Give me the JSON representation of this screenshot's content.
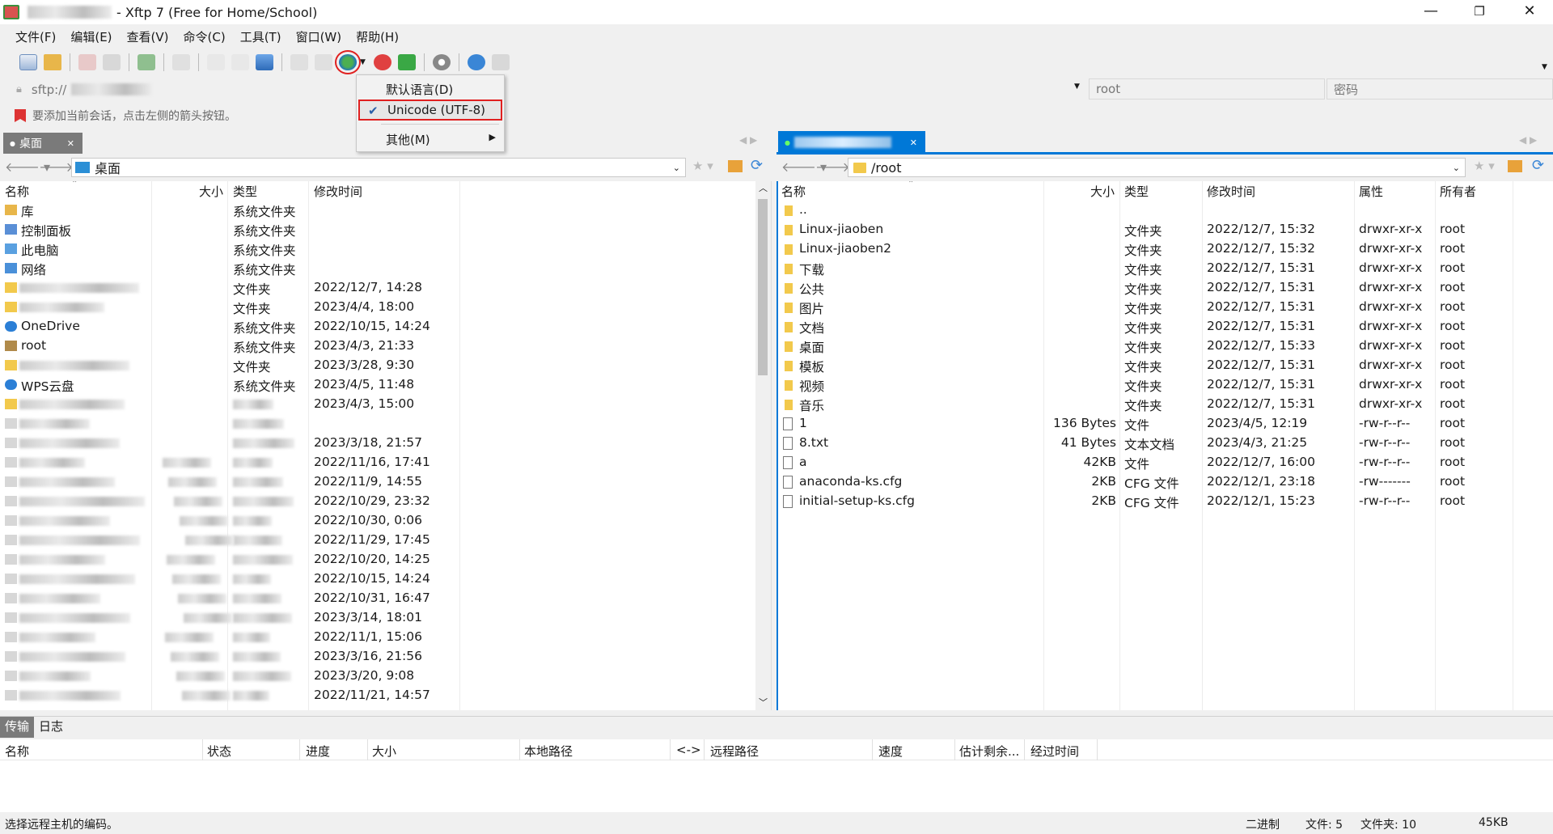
{
  "window": {
    "title": "- Xftp 7 (Free for Home/School)",
    "minimize": "—",
    "restore": "❐",
    "close": "✕"
  },
  "menu": [
    "文件(F)",
    "编辑(E)",
    "查看(V)",
    "命令(C)",
    "工具(T)",
    "窗口(W)",
    "帮助(H)"
  ],
  "address": {
    "host_prefix": "sftp://",
    "user": "root",
    "password_placeholder": "密码"
  },
  "hint": "要添加当前会话，点击左侧的箭头按钮。",
  "encoding_menu": {
    "items": [
      "默认语言(D)",
      "Unicode (UTF-8)",
      "其他(M)"
    ],
    "checked": "Unicode (UTF-8)"
  },
  "local": {
    "tab": "桌面",
    "path": "桌面",
    "columns": [
      "名称",
      "大小",
      "类型",
      "修改时间"
    ],
    "rows": [
      {
        "name": "库",
        "size": "",
        "type": "系统文件夹",
        "date": "",
        "icon": "library-icon",
        "blur": false
      },
      {
        "name": "控制面板",
        "size": "",
        "type": "系统文件夹",
        "date": "",
        "icon": "control-panel-icon",
        "blur": false
      },
      {
        "name": "此电脑",
        "size": "",
        "type": "系统文件夹",
        "date": "",
        "icon": "computer-icon",
        "blur": false
      },
      {
        "name": "网络",
        "size": "",
        "type": "系统文件夹",
        "date": "",
        "icon": "network-icon",
        "blur": false
      },
      {
        "name": "",
        "size": "",
        "type": "文件夹",
        "date": "2022/12/7, 14:28",
        "icon": "folder-icon",
        "blur": true
      },
      {
        "name": "",
        "size": "",
        "type": "文件夹",
        "date": "2023/4/4, 18:00",
        "icon": "folder-icon",
        "blur": true
      },
      {
        "name": "OneDrive",
        "size": "",
        "type": "系统文件夹",
        "date": "2022/10/15, 14:24",
        "icon": "cloud-icon",
        "blur": false
      },
      {
        "name": "root",
        "size": "",
        "type": "系统文件夹",
        "date": "2023/4/3, 21:33",
        "icon": "user-icon",
        "blur": false
      },
      {
        "name": "",
        "size": "",
        "type": "文件夹",
        "date": "2023/3/28, 9:30",
        "icon": "folder-icon",
        "blur": true
      },
      {
        "name": "WPS云盘",
        "size": "",
        "type": "系统文件夹",
        "date": "2023/4/5, 11:48",
        "icon": "cloud-icon",
        "blur": false
      },
      {
        "name": "",
        "size": "",
        "type": "",
        "date": "2023/4/3, 15:00",
        "icon": "folder-icon",
        "blur": true
      },
      {
        "name": "",
        "size": "",
        "type": "",
        "date": "",
        "icon": "file-icon",
        "blur": true
      },
      {
        "name": "",
        "size": "",
        "type": "",
        "date": "2023/3/18, 21:57",
        "icon": "file-icon",
        "blur": true
      },
      {
        "name": "",
        "size": "",
        "type": "",
        "date": "2022/11/16, 17:41",
        "icon": "file-icon",
        "blur": true
      },
      {
        "name": "",
        "size": "",
        "type": "",
        "date": "2022/11/9, 14:55",
        "icon": "file-icon",
        "blur": true
      },
      {
        "name": "",
        "size": "",
        "type": "",
        "date": "2022/10/29, 23:32",
        "icon": "file-icon",
        "blur": true
      },
      {
        "name": "",
        "size": "",
        "type": "",
        "date": "2022/10/30, 0:06",
        "icon": "file-icon",
        "blur": true
      },
      {
        "name": "",
        "size": "",
        "type": "",
        "date": "2022/11/29, 17:45",
        "icon": "file-icon",
        "blur": true
      },
      {
        "name": "",
        "size": "",
        "type": "",
        "date": "2022/10/20, 14:25",
        "icon": "file-icon",
        "blur": true
      },
      {
        "name": "",
        "size": "",
        "type": "",
        "date": "2022/10/15, 14:24",
        "icon": "file-icon",
        "blur": true
      },
      {
        "name": "",
        "size": "",
        "type": "",
        "date": "2022/10/31, 16:47",
        "icon": "file-icon",
        "blur": true
      },
      {
        "name": "",
        "size": "",
        "type": "",
        "date": "2023/3/14, 18:01",
        "icon": "file-icon",
        "blur": true
      },
      {
        "name": "",
        "size": "",
        "type": "",
        "date": "2022/11/1, 15:06",
        "icon": "file-icon",
        "blur": true
      },
      {
        "name": "",
        "size": "",
        "type": "",
        "date": "2023/3/16, 21:56",
        "icon": "file-icon",
        "blur": true
      },
      {
        "name": "",
        "size": "",
        "type": "",
        "date": "2023/3/20, 9:08",
        "icon": "file-icon",
        "blur": true
      },
      {
        "name": "",
        "size": "",
        "type": "",
        "date": "2022/11/21, 14:57",
        "icon": "file-icon",
        "blur": true
      }
    ]
  },
  "remote": {
    "path": "/root",
    "columns": [
      "名称",
      "大小",
      "类型",
      "修改时间",
      "属性",
      "所有者"
    ],
    "rows": [
      {
        "name": "..",
        "size": "",
        "type": "",
        "date": "",
        "attr": "",
        "owner": "",
        "icon": "folder-icon"
      },
      {
        "name": "Linux-jiaoben",
        "size": "",
        "type": "文件夹",
        "date": "2022/12/7, 15:32",
        "attr": "drwxr-xr-x",
        "owner": "root",
        "icon": "folder-icon"
      },
      {
        "name": "Linux-jiaoben2",
        "size": "",
        "type": "文件夹",
        "date": "2022/12/7, 15:32",
        "attr": "drwxr-xr-x",
        "owner": "root",
        "icon": "folder-icon"
      },
      {
        "name": "下载",
        "size": "",
        "type": "文件夹",
        "date": "2022/12/7, 15:31",
        "attr": "drwxr-xr-x",
        "owner": "root",
        "icon": "folder-icon"
      },
      {
        "name": "公共",
        "size": "",
        "type": "文件夹",
        "date": "2022/12/7, 15:31",
        "attr": "drwxr-xr-x",
        "owner": "root",
        "icon": "folder-icon"
      },
      {
        "name": "图片",
        "size": "",
        "type": "文件夹",
        "date": "2022/12/7, 15:31",
        "attr": "drwxr-xr-x",
        "owner": "root",
        "icon": "folder-icon"
      },
      {
        "name": "文档",
        "size": "",
        "type": "文件夹",
        "date": "2022/12/7, 15:31",
        "attr": "drwxr-xr-x",
        "owner": "root",
        "icon": "folder-icon"
      },
      {
        "name": "桌面",
        "size": "",
        "type": "文件夹",
        "date": "2022/12/7, 15:33",
        "attr": "drwxr-xr-x",
        "owner": "root",
        "icon": "folder-icon"
      },
      {
        "name": "模板",
        "size": "",
        "type": "文件夹",
        "date": "2022/12/7, 15:31",
        "attr": "drwxr-xr-x",
        "owner": "root",
        "icon": "folder-icon"
      },
      {
        "name": "视频",
        "size": "",
        "type": "文件夹",
        "date": "2022/12/7, 15:31",
        "attr": "drwxr-xr-x",
        "owner": "root",
        "icon": "folder-icon"
      },
      {
        "name": "音乐",
        "size": "",
        "type": "文件夹",
        "date": "2022/12/7, 15:31",
        "attr": "drwxr-xr-x",
        "owner": "root",
        "icon": "folder-icon"
      },
      {
        "name": "1",
        "size": "136 Bytes",
        "type": "文件",
        "date": "2023/4/5, 12:19",
        "attr": "-rw-r--r--",
        "owner": "root",
        "icon": "file-icon"
      },
      {
        "name": "8.txt",
        "size": "41 Bytes",
        "type": "文本文档",
        "date": "2023/4/3, 21:25",
        "attr": "-rw-r--r--",
        "owner": "root",
        "icon": "file-icon"
      },
      {
        "name": "a",
        "size": "42KB",
        "type": "文件",
        "date": "2022/12/7, 16:00",
        "attr": "-rw-r--r--",
        "owner": "root",
        "icon": "file-icon"
      },
      {
        "name": "anaconda-ks.cfg",
        "size": "2KB",
        "type": "CFG 文件",
        "date": "2022/12/1, 23:18",
        "attr": "-rw-------",
        "owner": "root",
        "icon": "file-icon"
      },
      {
        "name": "initial-setup-ks.cfg",
        "size": "2KB",
        "type": "CFG 文件",
        "date": "2022/12/1, 15:23",
        "attr": "-rw-r--r--",
        "owner": "root",
        "icon": "file-icon"
      }
    ]
  },
  "bottom": {
    "tabs": [
      "传输",
      "日志"
    ],
    "columns": [
      "名称",
      "状态",
      "进度",
      "大小",
      "本地路径",
      "<->",
      "远程路径",
      "速度",
      "估计剩余...",
      "经过时间"
    ]
  },
  "status": {
    "message": "选择远程主机的编码。",
    "mode": "二进制",
    "files": "文件: 5",
    "folders": "文件夹: 10",
    "size": "45KB"
  },
  "colors": {
    "accent": "#0078d7",
    "highlight_box": "#e02020",
    "folder": "#f2c94c"
  }
}
